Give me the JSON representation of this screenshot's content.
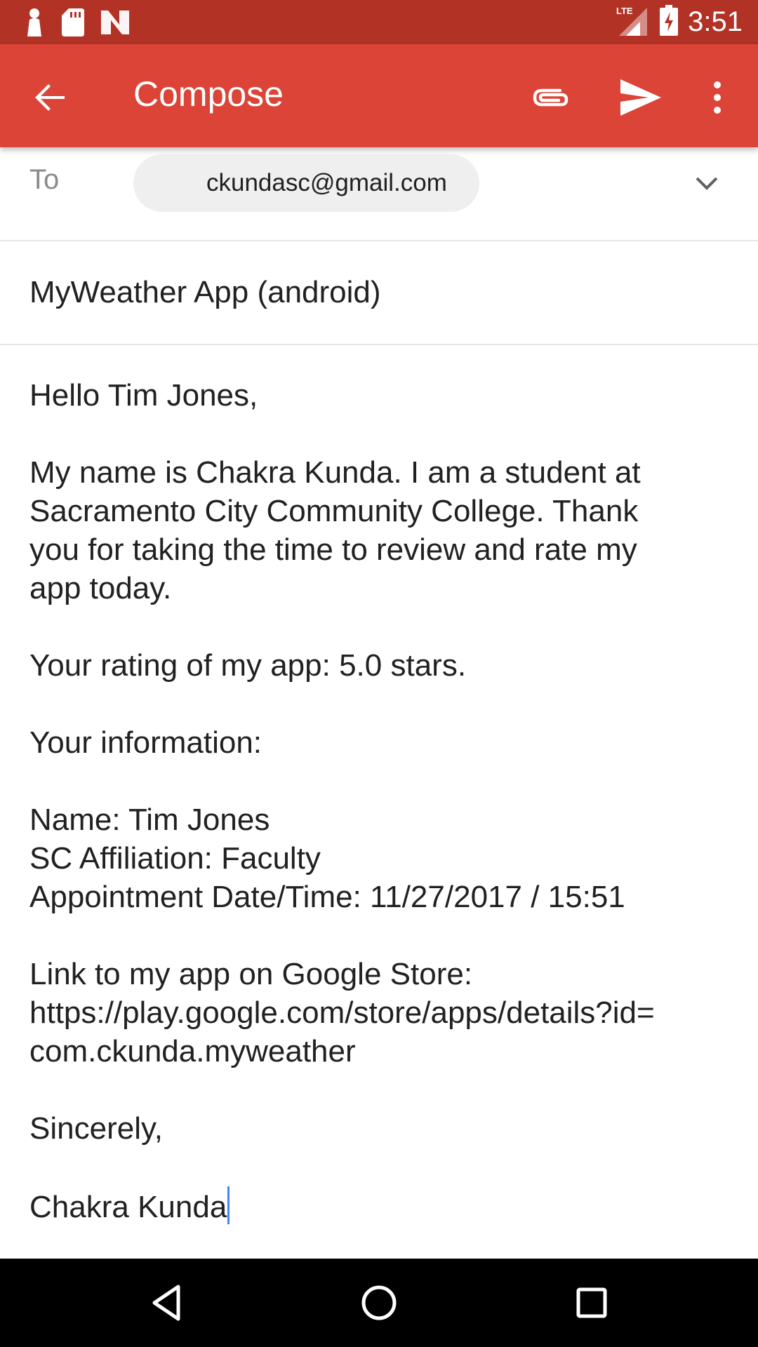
{
  "status_bar": {
    "time": "3:51",
    "network": "LTE",
    "icons": [
      "notification-person-icon",
      "sd-card-icon",
      "app-n-icon",
      "lte-signal-icon",
      "battery-charging-icon"
    ]
  },
  "app_bar": {
    "title": "Compose",
    "icons": [
      "back-arrow-icon",
      "attach-icon",
      "send-icon",
      "more-vert-icon"
    ],
    "color": "#db4437",
    "status_color": "#b23226"
  },
  "to": {
    "label": "To",
    "recipient": "ckundasc@gmail.com"
  },
  "subject": "MyWeather App (android)",
  "body": {
    "greeting": "Hello Tim Jones,",
    "intro": [
      "My name is Chakra Kunda. I am a student at",
      "Sacramento City Community College. Thank",
      "you for taking the time to review and rate my",
      "app today."
    ],
    "rating": "Your rating of my app: 5.0 stars.",
    "info_heading": "Your information:",
    "info": [
      "Name: Tim Jones",
      "SC Affiliation: Faculty",
      "Appointment Date/Time: 11/27/2017 / 15:51"
    ],
    "link": [
      "Link to my app on Google Store:",
      "https://play.google.com/store/apps/details?id=",
      "com.ckunda.myweather"
    ],
    "closing": "Sincerely,",
    "signature": "Chakra Kunda"
  },
  "nav_bar": {
    "icons": [
      "nav-back-icon",
      "nav-home-icon",
      "nav-recents-icon"
    ]
  }
}
